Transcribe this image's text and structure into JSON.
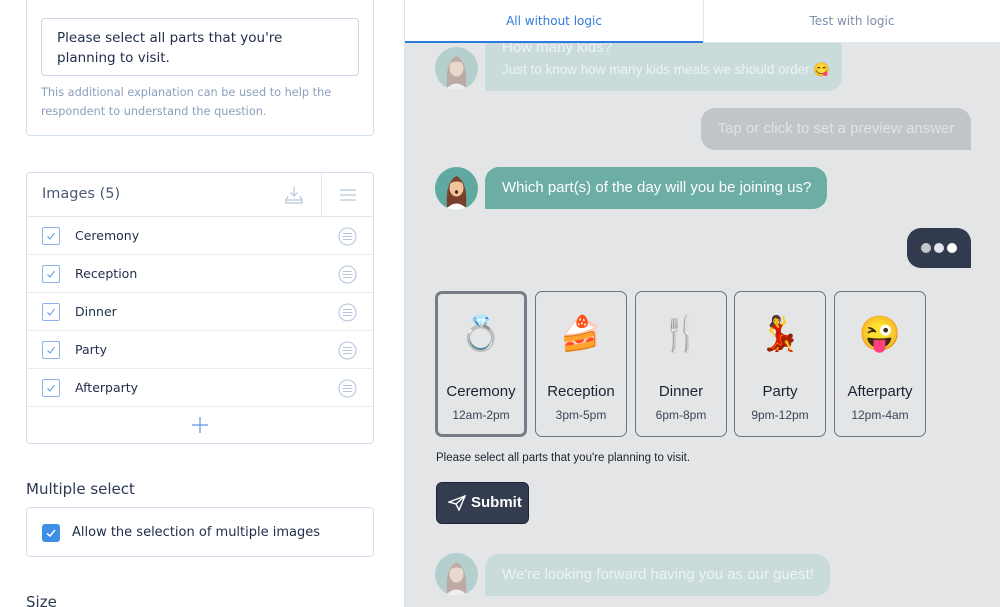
{
  "editor": {
    "question_text": "Please select all parts that you're planning to visit.",
    "help_text": "This additional explanation can be used to help the respondent to understand the question.",
    "images": {
      "title": "Images (5)",
      "items": [
        {
          "label": "Ceremony",
          "checked": true
        },
        {
          "label": "Reception",
          "checked": true
        },
        {
          "label": "Dinner",
          "checked": true
        },
        {
          "label": "Party",
          "checked": true
        },
        {
          "label": "Afterparty",
          "checked": true
        }
      ]
    },
    "multiple_select": {
      "title": "Multiple select",
      "option_label": "Allow the selection of multiple images",
      "checked": true
    },
    "size": {
      "title": "Size"
    }
  },
  "preview": {
    "tabs": [
      {
        "label": "All without logic",
        "active": true
      },
      {
        "label": "Test with logic",
        "active": false
      }
    ],
    "messages": {
      "prev_question_title": "How many kids?",
      "prev_question_sub": "Just to know how many kids meals we should order 😋",
      "answer_placeholder": "Tap or click to set a preview answer",
      "current_question": "Which part(s) of the day will you be joining us?",
      "next_message": "We're looking forward having you as our guest!"
    },
    "options": [
      {
        "emoji": "💍",
        "title": "Ceremony",
        "time": "12am-2pm",
        "selected": true
      },
      {
        "emoji": "🍰",
        "title": "Reception",
        "time": "3pm-5pm",
        "selected": false
      },
      {
        "emoji": "🍴",
        "title": "Dinner",
        "time": "6pm-8pm",
        "selected": false
      },
      {
        "emoji": "💃",
        "title": "Party",
        "time": "9pm-12pm",
        "selected": false
      },
      {
        "emoji": "😜",
        "title": "Afterparty",
        "time": "12pm-4am",
        "selected": false
      }
    ],
    "description": "Please select all parts that you're planning to visit.",
    "submit_label": "Submit",
    "colors": {
      "bot_bubble": "#6cada4",
      "dark": "#343c50",
      "accent": "#2e7be0"
    }
  }
}
